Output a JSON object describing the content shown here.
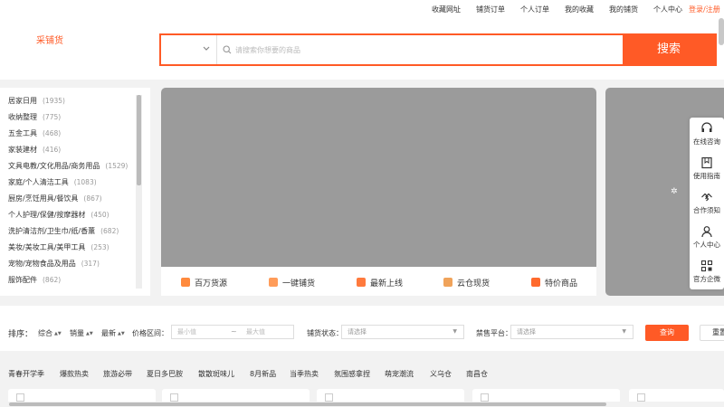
{
  "topnav": {
    "items": [
      "收藏网址",
      "铺货订单",
      "个人订单",
      "我的收藏",
      "我的铺货",
      "个人中心"
    ],
    "login": "登录/注册"
  },
  "header": {
    "logo": "采铺货",
    "search_placeholder": "请搜索你想要的商品",
    "search_button": "搜索"
  },
  "categories": [
    {
      "name": "居家日用",
      "count": "(1935)"
    },
    {
      "name": "收纳整理",
      "count": "(775)"
    },
    {
      "name": "五金工具",
      "count": "(468)"
    },
    {
      "name": "家装建材",
      "count": "(416)"
    },
    {
      "name": "文具电教/文化用品/商务用品",
      "count": "(1529)"
    },
    {
      "name": "家庭/个人清洁工具",
      "count": "(1083)"
    },
    {
      "name": "厨房/烹饪用具/餐饮具",
      "count": "(867)"
    },
    {
      "name": "个人护理/保健/按摩器材",
      "count": "(450)"
    },
    {
      "name": "洗护清洁剂/卫生巾/纸/香薰",
      "count": "(682)"
    },
    {
      "name": "美妆/美妆工具/美甲工具",
      "count": "(253)"
    },
    {
      "name": "宠物/宠物食品及用品",
      "count": "(317)"
    },
    {
      "name": "服饰配件",
      "count": "(862)"
    }
  ],
  "banner_tabs": [
    "百万货源",
    "一键铺货",
    "最新上线",
    "云仓现货",
    "特价商品"
  ],
  "float_menu": [
    "在线咨询",
    "使用指南",
    "合作须知",
    "个人中心",
    "官方企微"
  ],
  "filters": {
    "sort_label": "排序：",
    "sort_items": [
      "综合",
      "销量",
      "最新"
    ],
    "price_label": "价格区间：",
    "price_min_placeholder": "最小值",
    "price_tilde": "~",
    "price_max_placeholder": "最大值",
    "status_label": "铺货状态：",
    "status_placeholder": "请选择",
    "platform_label": "禁售平台：",
    "platform_placeholder": "请选择",
    "query_button": "查询",
    "reset_button": "重置"
  },
  "tags": [
    "青春开学季",
    "爆款热卖",
    "旅游必带",
    "夏日多巴胺",
    "散散斑味儿",
    "8月新品",
    "当季热卖",
    "氛围感拿捏",
    "萌宠潮流",
    "义乌仓",
    "南昌仓"
  ],
  "colors": {
    "accent": "#ff5a26",
    "banner_bg": "#9b9b9b",
    "page_bg": "#f2f2f2"
  }
}
